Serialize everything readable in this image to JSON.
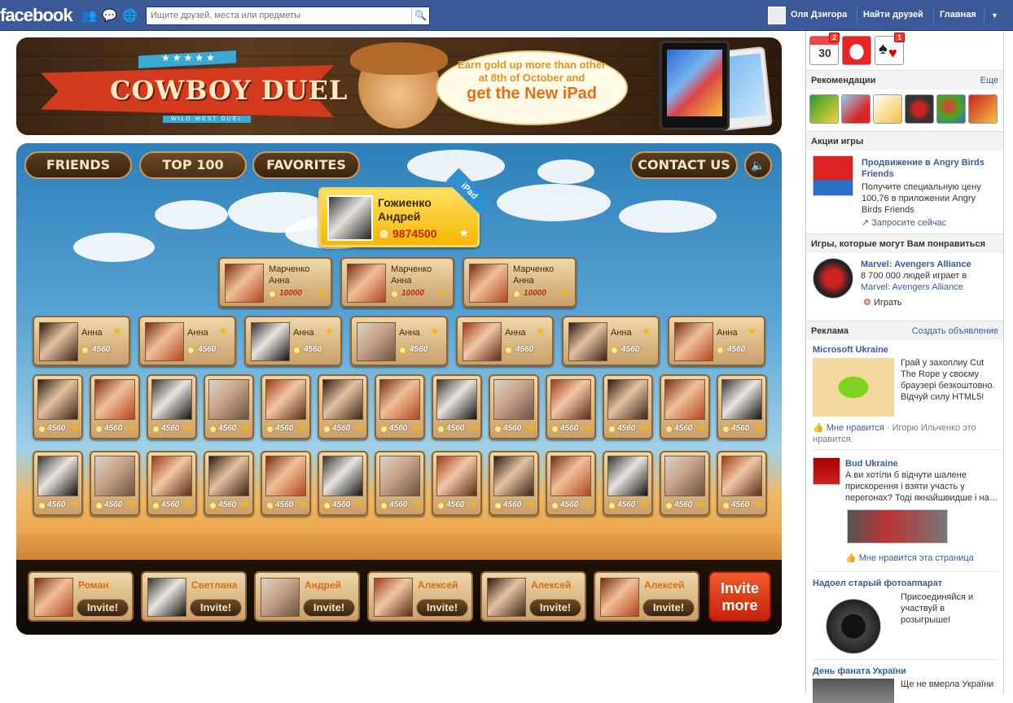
{
  "topbar": {
    "logo": "facebook",
    "search_placeholder": "Ищите друзей, места или предметы",
    "user_name": "Оля Дзигора",
    "find_friends": "Найти друзей",
    "home": "Главная"
  },
  "banner": {
    "title": "COWBOY DUEL",
    "subtitle": "WILD WEST DUEL",
    "stars": "★★★★★",
    "bubble_line1": "Earn gold up more than other",
    "bubble_line2": "at 8th of October and",
    "bubble_line3": "get the New iPad"
  },
  "board": {
    "tabs": [
      "FRIENDS",
      "TOP 100",
      "FAVORITES"
    ],
    "contact": "CONTACT US",
    "leader": {
      "name1": "Гожиенко",
      "name2": "Андрей",
      "score": "9874500",
      "ribbon": "iPad"
    },
    "row1": [
      {
        "name1": "Марченко",
        "name2": "Анна",
        "score": "10000"
      },
      {
        "name1": "Марченко",
        "name2": "Анна",
        "score": "10000"
      },
      {
        "name1": "Марченко",
        "name2": "Анна",
        "score": "10000"
      }
    ],
    "row2": [
      {
        "name": "Анна",
        "score": "4560"
      },
      {
        "name": "Анна",
        "score": "4560"
      },
      {
        "name": "Анна",
        "score": "4560"
      },
      {
        "name": "Анна",
        "score": "4560"
      },
      {
        "name": "Анна",
        "score": "4560"
      },
      {
        "name": "Анна",
        "score": "4560"
      },
      {
        "name": "Анна",
        "score": "4560"
      }
    ],
    "small_score": "4560",
    "invites": [
      {
        "name": "Роман",
        "button": "Invite!"
      },
      {
        "name": "Светлана",
        "button": "Invite!"
      },
      {
        "name": "Андрей",
        "button": "Invite!"
      },
      {
        "name": "Алексей",
        "button": "Invite!"
      },
      {
        "name": "Алексей",
        "button": "Invite!"
      },
      {
        "name": "Алексей",
        "button": "Invite!"
      }
    ],
    "invite_more_1": "Invite",
    "invite_more_2": "more"
  },
  "rail": {
    "games_badges": [
      {
        "value": "30",
        "badge": "2"
      },
      {
        "value": "",
        "badge": ""
      },
      {
        "value": "",
        "badge": "1"
      }
    ],
    "recommendations": "Рекомендации",
    "more": "Еще",
    "game_actions": "Акции игры",
    "promo_title": "Продвижение в Angry Birds Friends",
    "promo_text": "Получите специальную цену 100,76 в приложении Angry Birds Friends",
    "promo_link": "Запросите сейчас",
    "games_like": "Игры, которые могут Вам понравиться",
    "marvel_title": "Marvel: Avengers Alliance",
    "marvel_text1": "8 700 000 людей играет в",
    "marvel_text2": "Marvel: Avengers Alliance",
    "marvel_play": "Играть",
    "ads": "Реклама",
    "create_ad": "Создать объявление",
    "ad1_title": "Microsoft Ukraine",
    "ad1_text": "Грай у захоплиу Cut The Rope у своєму браузері безкоштовно. Відчуй силу HTML5!",
    "ad1_like": "Мне нравится",
    "ad1_like_rest": " · Игорю Ильченко это нравится.",
    "ad2_title": "Bud Ukraine",
    "ad2_text": "А ви хотіли б відчути шалене прискорення і взяти участь у перегонах? Тоді якнайшвидше і на…",
    "ad2_like": "Мне нравится эта страница",
    "ad3_title": "Надоел старый фотоаппарат",
    "ad3_text": "Присоединяйся и участвуй в розыгрыше!",
    "ad4_title": "День фаната України",
    "ad4_text": "Ще не вмерла України"
  },
  "colors": {
    "fb_blue": "#3b5998",
    "gold": "#f5b700",
    "invite_red": "#d9321a"
  }
}
